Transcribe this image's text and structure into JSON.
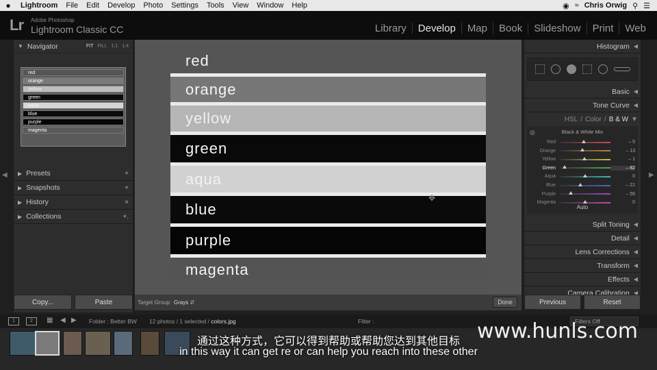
{
  "menubar": {
    "apple": "",
    "items": [
      "Lightroom",
      "File",
      "Edit",
      "Develop",
      "Photo",
      "Settings",
      "Tools",
      "View",
      "Window",
      "Help"
    ],
    "user": "Chris Orwig"
  },
  "identity": {
    "logo": "Lr",
    "small": "Adobe Photoshop",
    "name": "Lightroom Classic CC"
  },
  "modules": [
    {
      "label": "Library",
      "active": false
    },
    {
      "label": "Develop",
      "active": true
    },
    {
      "label": "Map",
      "active": false
    },
    {
      "label": "Book",
      "active": false
    },
    {
      "label": "Slideshow",
      "active": false
    },
    {
      "label": "Print",
      "active": false
    },
    {
      "label": "Web",
      "active": false
    }
  ],
  "left": {
    "navigator": {
      "title": "Navigator",
      "zoom": [
        "FIT",
        "FILL",
        "1:1",
        "1:4"
      ]
    },
    "nav_strips": [
      {
        "label": "red",
        "bg": "#555555",
        "fg": "#ffffff"
      },
      {
        "label": "orange",
        "bg": "#7a7a7a",
        "fg": "#ffffff"
      },
      {
        "label": "yellow",
        "bg": "#bdbdbd",
        "fg": "#f0f0f0"
      },
      {
        "label": "green",
        "bg": "#0a0a0a",
        "fg": "#ffffff"
      },
      {
        "label": "aqua",
        "bg": "#d6d6d6",
        "fg": "#f0f0f0"
      },
      {
        "label": "blue",
        "bg": "#0a0a0a",
        "fg": "#ffffff"
      },
      {
        "label": "purple",
        "bg": "#050505",
        "fg": "#ffffff"
      },
      {
        "label": "magenta",
        "bg": "#5a5a5a",
        "fg": "#ffffff"
      }
    ],
    "sections": [
      {
        "label": "Presets",
        "action": "+"
      },
      {
        "label": "Snapshots",
        "action": "+"
      },
      {
        "label": "History",
        "action": "×"
      },
      {
        "label": "Collections",
        "action": "+."
      }
    ],
    "copy_label": "Copy...",
    "paste_label": "Paste"
  },
  "photo": {
    "stripes": [
      {
        "label": "red",
        "bg": "#555555",
        "fg": "#f4f4f4"
      },
      {
        "label": "orange",
        "bg": "#777777",
        "fg": "#f4f4f4"
      },
      {
        "label": "yellow",
        "bg": "#b5b5b5",
        "fg": "#f0f0f0"
      },
      {
        "label": "green",
        "bg": "#090909",
        "fg": "#f4f4f4"
      },
      {
        "label": "aqua",
        "bg": "#d1d1d1",
        "fg": "#f2f2f2"
      },
      {
        "label": "blue",
        "bg": "#0a0a0a",
        "fg": "#f4f4f4"
      },
      {
        "label": "purple",
        "bg": "#050505",
        "fg": "#f4f4f4"
      },
      {
        "label": "magenta",
        "bg": "#545454",
        "fg": "#f4f4f4"
      }
    ]
  },
  "toolbar": {
    "target_label": "Target Group:",
    "target_value": "Grays",
    "done_label": "Done"
  },
  "right": {
    "histogram": "Histogram",
    "basic": "Basic",
    "tone_curve": "Tone Curve",
    "hsl_tabs": {
      "hsl": "HSL",
      "sep": "/",
      "color": "Color",
      "sep2": "/",
      "bw": "B & W"
    },
    "bw_title": "Black & White Mix",
    "bw_rows": [
      {
        "label": "Red",
        "value": "– 5",
        "pos": 0.47,
        "color": "#c94a4a",
        "active": false
      },
      {
        "label": "Orange",
        "value": "– 13",
        "pos": 0.45,
        "color": "#c8813a",
        "active": false
      },
      {
        "label": "Yellow",
        "value": "– 1",
        "pos": 0.49,
        "color": "#c8c23a",
        "active": false
      },
      {
        "label": "Green",
        "value": "– 82",
        "pos": 0.09,
        "color": "#4ab04a",
        "active": true
      },
      {
        "label": "Aqua",
        "value": "0",
        "pos": 0.5,
        "color": "#3ab8b8",
        "active": false
      },
      {
        "label": "Blue",
        "value": "– 21",
        "pos": 0.4,
        "color": "#4a6ad0",
        "active": false
      },
      {
        "label": "Purple",
        "value": "– 56",
        "pos": 0.22,
        "color": "#9a4ac8",
        "active": false
      },
      {
        "label": "Magenta",
        "value": "0",
        "pos": 0.5,
        "color": "#c84aa8",
        "active": false
      }
    ],
    "auto": "Auto",
    "more": [
      "Split Toning",
      "Detail",
      "Lens Corrections",
      "Transform",
      "Effects",
      "Camera Calibration"
    ],
    "previous_label": "Previous",
    "reset_label": "Reset"
  },
  "filmstrip": {
    "screen1": "1",
    "screen2": "2",
    "folder": "Folder : Better BW",
    "count": "12 photos / 1 selected /",
    "file": "colors.jpg",
    "filter_label": "Filter :",
    "filters_off": "Filters Off"
  },
  "overlay": {
    "watermark": "www.hunls.com",
    "subtitle_cn": "通过这种方式，它可以得到帮助或帮助您达到其他目标",
    "subtitle_en": "in this way it can get re or can help you reach into these other"
  }
}
